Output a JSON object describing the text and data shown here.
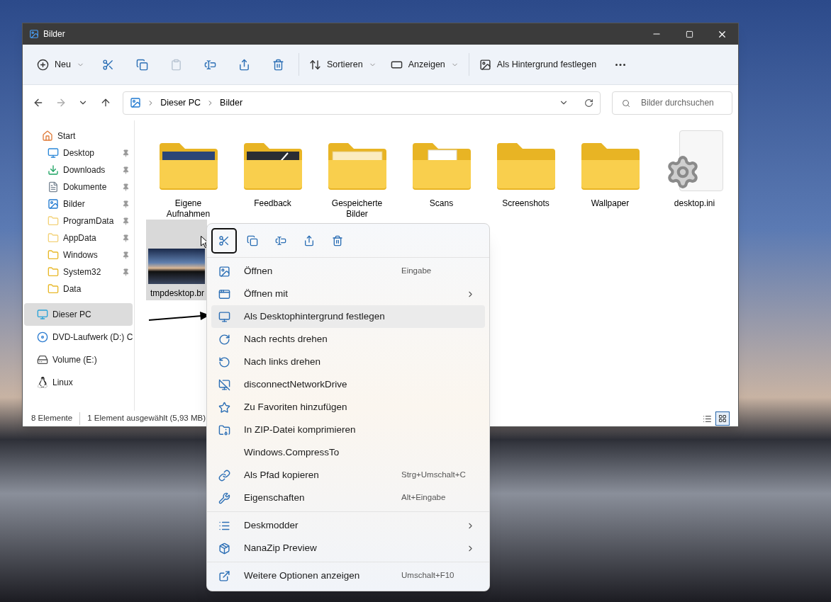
{
  "window": {
    "title": "Bilder"
  },
  "toolbar_groups": [
    {
      "items": [
        {
          "kind": "dropdown",
          "label": "Neu",
          "disabled": false
        },
        {
          "kind": "icon",
          "disabled": false
        },
        {
          "kind": "icon",
          "disabled": false
        },
        {
          "kind": "icon",
          "disabled": true
        },
        {
          "kind": "icon",
          "disabled": false
        },
        {
          "kind": "icon",
          "disabled": false
        },
        {
          "kind": "icon",
          "disabled": false
        }
      ]
    },
    {
      "items": [
        {
          "kind": "dropdown",
          "label": "Sortieren",
          "disabled": false
        },
        {
          "kind": "dropdown",
          "label": "Anzeigen",
          "disabled": false
        }
      ]
    },
    {
      "items": [
        {
          "kind": "button",
          "label": "Als Hintergrund festlegen",
          "disabled": false
        },
        {
          "kind": "icon",
          "disabled": false
        }
      ]
    }
  ],
  "address": {
    "path": [
      "Dieser PC",
      "Bilder"
    ]
  },
  "search": {
    "placeholder": "Bilder durchsuchen"
  },
  "sidebar": {
    "groups": [
      {
        "items": [
          {
            "label": "Start",
            "pinned": false,
            "selected": false
          },
          {
            "label": "Desktop",
            "pinned": true,
            "selected": false
          },
          {
            "label": "Downloads",
            "pinned": true,
            "selected": false
          },
          {
            "label": "Dokumente",
            "pinned": true,
            "selected": false
          },
          {
            "label": "Bilder",
            "pinned": true,
            "selected": false
          },
          {
            "label": "ProgramData",
            "pinned": true,
            "selected": false
          },
          {
            "label": "AppData",
            "pinned": true,
            "selected": false
          },
          {
            "label": "Windows",
            "pinned": true,
            "selected": false
          },
          {
            "label": "System32",
            "pinned": true,
            "selected": false
          },
          {
            "label": "Data",
            "pinned": false,
            "selected": false
          }
        ]
      },
      {
        "items": [
          {
            "label": "Dieser PC",
            "pinned": false,
            "selected": true
          },
          {
            "label": "DVD-Laufwerk (D:) C",
            "pinned": false,
            "selected": false
          },
          {
            "label": "Volume (E:)",
            "pinned": false,
            "selected": false
          },
          {
            "label": "Linux",
            "pinned": false,
            "selected": false
          }
        ]
      }
    ]
  },
  "files": [
    {
      "kind": "folder",
      "label": "Eigene Aufnahmen",
      "selected": false
    },
    {
      "kind": "folder",
      "label": "Feedback",
      "selected": false
    },
    {
      "kind": "folder",
      "label": "Gespeicherte Bilder",
      "selected": false
    },
    {
      "kind": "folder",
      "label": "Scans",
      "selected": false
    },
    {
      "kind": "folder",
      "label": "Screenshots",
      "selected": false
    },
    {
      "kind": "folder",
      "label": "Wallpaper",
      "selected": false
    },
    {
      "kind": "settings",
      "label": "desktop.ini",
      "selected": false
    },
    {
      "kind": "image",
      "label": "tmpdesktop.br",
      "selected": true
    }
  ],
  "status_bar": {
    "count": "8 Elemente",
    "selection": "1 Element ausgewählt (5,93 MB)"
  },
  "view_buttons": [
    {
      "selected": false
    },
    {
      "selected": true
    }
  ],
  "context_menu": {
    "quick_actions": [
      {
        "selected": true
      },
      {
        "selected": false
      },
      {
        "selected": false
      },
      {
        "selected": false
      },
      {
        "selected": false
      }
    ],
    "sections": [
      {
        "items": [
          {
            "label": "Öffnen",
            "shortcut": "Eingabe",
            "submenu": false,
            "highlighted": false
          },
          {
            "label": "Öffnen mit",
            "submenu": true,
            "highlighted": false
          },
          {
            "label": "Als Desktophintergrund festlegen",
            "submenu": false,
            "highlighted": true
          },
          {
            "label": "Nach rechts drehen",
            "submenu": false,
            "highlighted": false
          },
          {
            "label": "Nach links drehen",
            "submenu": false,
            "highlighted": false
          },
          {
            "label": "disconnectNetworkDrive",
            "submenu": false,
            "highlighted": false
          },
          {
            "label": "Zu Favoriten hinzufügen",
            "submenu": false,
            "highlighted": false
          },
          {
            "label": "In ZIP-Datei komprimieren",
            "submenu": false,
            "highlighted": false
          },
          {
            "label": "Windows.CompressTo",
            "submenu": false,
            "highlighted": false
          },
          {
            "label": "Als Pfad kopieren",
            "shortcut": "Strg+Umschalt+C",
            "submenu": false,
            "highlighted": false
          },
          {
            "label": "Eigenschaften",
            "shortcut": "Alt+Eingabe",
            "submenu": false,
            "highlighted": false
          }
        ]
      },
      {
        "items": [
          {
            "label": "Deskmodder",
            "submenu": true,
            "highlighted": false
          },
          {
            "label": "NanaZip Preview",
            "submenu": true,
            "highlighted": false
          }
        ]
      },
      {
        "items": [
          {
            "label": "Weitere Optionen anzeigen",
            "shortcut": "Umschalt+F10",
            "submenu": false,
            "highlighted": false
          }
        ]
      }
    ]
  }
}
